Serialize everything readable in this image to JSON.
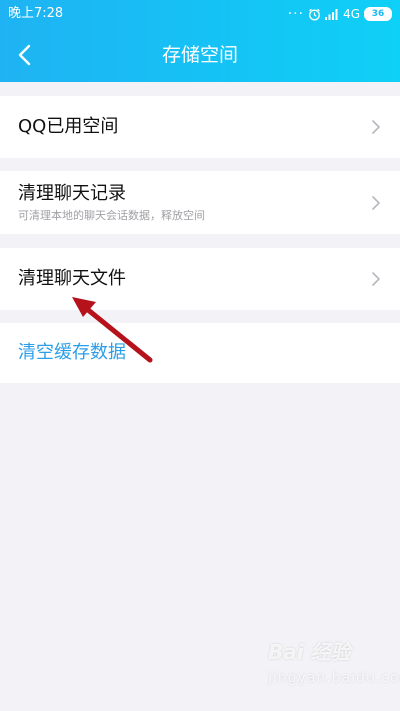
{
  "status_bar": {
    "time": "晚上7:28",
    "network": "4G",
    "battery": "36",
    "dots": "···"
  },
  "nav": {
    "title": "存储空间"
  },
  "rows": [
    {
      "title": "QQ已用空间"
    },
    {
      "title": "清理聊天记录",
      "subtitle": "可清理本地的聊天会话数据，释放空间"
    },
    {
      "title": "清理聊天文件"
    }
  ],
  "clear_cache": {
    "label": "清空缓存数据"
  },
  "watermark": {
    "main": "Bai 经验",
    "sub": "jingyan.baidu.com"
  },
  "colors": {
    "header_start": "#1fb3f3",
    "header_end": "#0fd0f6",
    "link": "#2c9ee8",
    "arrow": "#b5121b",
    "background": "#f3f3f7"
  }
}
